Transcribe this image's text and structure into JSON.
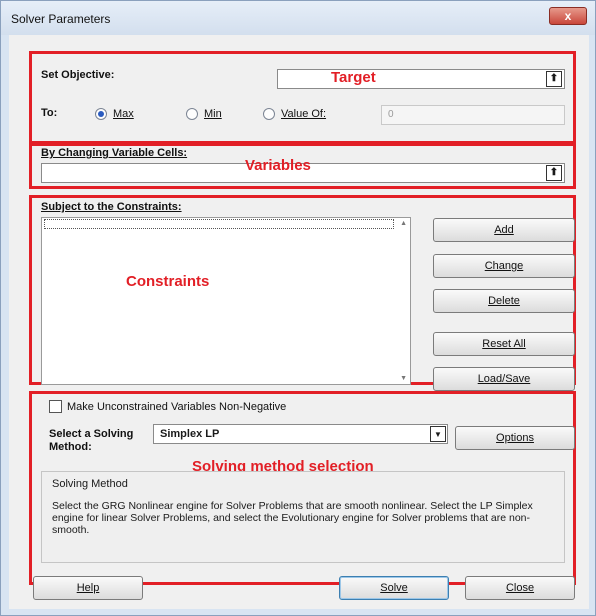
{
  "window": {
    "title": "Solver Parameters",
    "close_glyph": "x"
  },
  "objective": {
    "set_label": "Set Objective:",
    "value": "",
    "to_label": "To:",
    "options": {
      "max": "Max",
      "min": "Min",
      "value_of": "Value Of:"
    },
    "selected": "Max",
    "value_of_input": "0"
  },
  "variables": {
    "label": "By Changing Variable Cells:",
    "value": ""
  },
  "constraints": {
    "label": "Subject to the Constraints:",
    "items": [],
    "buttons": {
      "add": "Add",
      "change": "Change",
      "delete": "Delete",
      "reset_all": "Reset All",
      "load_save": "Load/Save"
    }
  },
  "nonneg": {
    "label": "Make Unconstrained Variables Non-Negative",
    "checked": false
  },
  "method": {
    "label_line1": "Select a Solving",
    "label_line2": "Method:",
    "selected": "Simplex LP",
    "options_button": "Options",
    "group_title": "Solving Method",
    "description": "Select the GRG Nonlinear engine for Solver Problems that are smooth nonlinear. Select the LP Simplex engine for linear Solver Problems, and select the Evolutionary engine for Solver problems that are non-smooth."
  },
  "footer": {
    "help": "Help",
    "solve": "Solve",
    "close": "Close"
  },
  "annotations": {
    "target": "Target",
    "variables": "Variables",
    "constraints": "Constraints",
    "solving_method": "Solving method selection"
  },
  "colors": {
    "annotation_red": "#e21f26",
    "radio_selected": "#2a5bbf"
  },
  "icons": {
    "reference_button": "collapse-dialog-icon",
    "dropdown": "dropdown-arrow-icon"
  }
}
